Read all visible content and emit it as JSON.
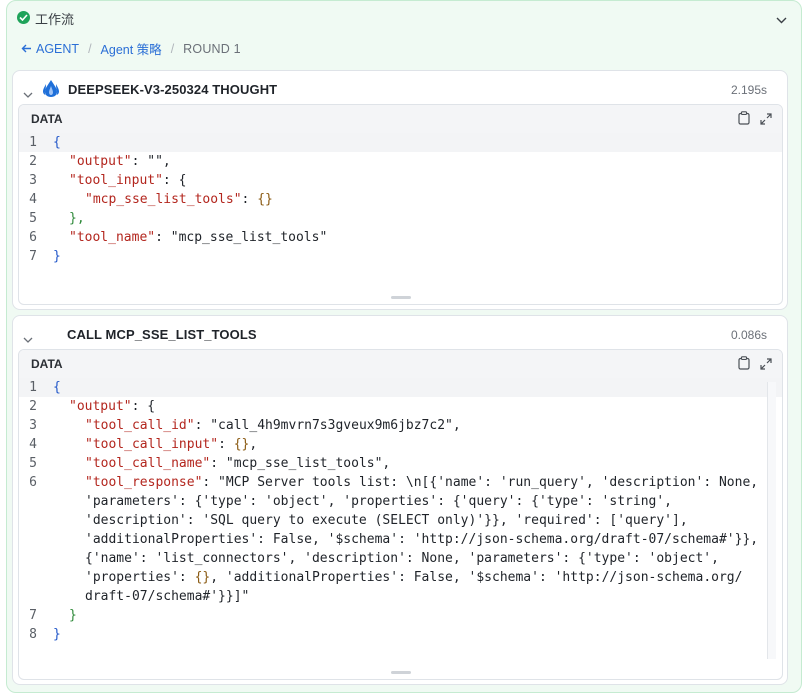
{
  "workflow": {
    "title": "工作流"
  },
  "breadcrumb": {
    "back": "AGENT",
    "middle": "Agent 策略",
    "current": "ROUND 1"
  },
  "panels": [
    {
      "title": "DEEPSEEK-V3-250324 THOUGHT",
      "time": "2.195s",
      "data_label": "DATA",
      "line_numbers": [
        "1",
        "2",
        "3",
        "4",
        "5",
        "6",
        "7"
      ],
      "lines": [
        "{",
        "\"output\": \"\",",
        "\"tool_input\": {",
        "\"mcp_sse_list_tools\": {}",
        "},",
        "\"tool_name\": \"mcp_sse_list_tools\"",
        "}"
      ]
    },
    {
      "title": "CALL MCP_SSE_LIST_TOOLS",
      "time": "0.086s",
      "data_label": "DATA",
      "line_numbers": [
        "1",
        "2",
        "3",
        "4",
        "5",
        "6",
        "7",
        "8"
      ],
      "lines": [
        "{",
        "\"output\": {",
        "\"tool_call_id\": \"call_4h9mvrn7s3gveux9m6jbz7c2\",",
        "\"tool_call_input\": {},",
        "\"tool_call_name\": \"mcp_sse_list_tools\",",
        "\"tool_response\": \"MCP Server tools list: \\n[{'name': 'run_query', 'description': None,",
        "'parameters': {'type': 'object', 'properties': {'query': {'type': 'string',",
        "'description': 'SQL query to execute (SELECT only)'}}, 'required': ['query'],",
        "'additionalProperties': False, '$schema': 'http://json-schema.org/draft-07/schema#'}},",
        "{'name': 'list_connectors', 'description': None, 'parameters': {'type': 'object',",
        "'properties': {}, 'additionalProperties': False, '$schema': 'http://json-schema.org/",
        "draft-07/schema#'}}]\"",
        "}",
        "}"
      ]
    }
  ]
}
